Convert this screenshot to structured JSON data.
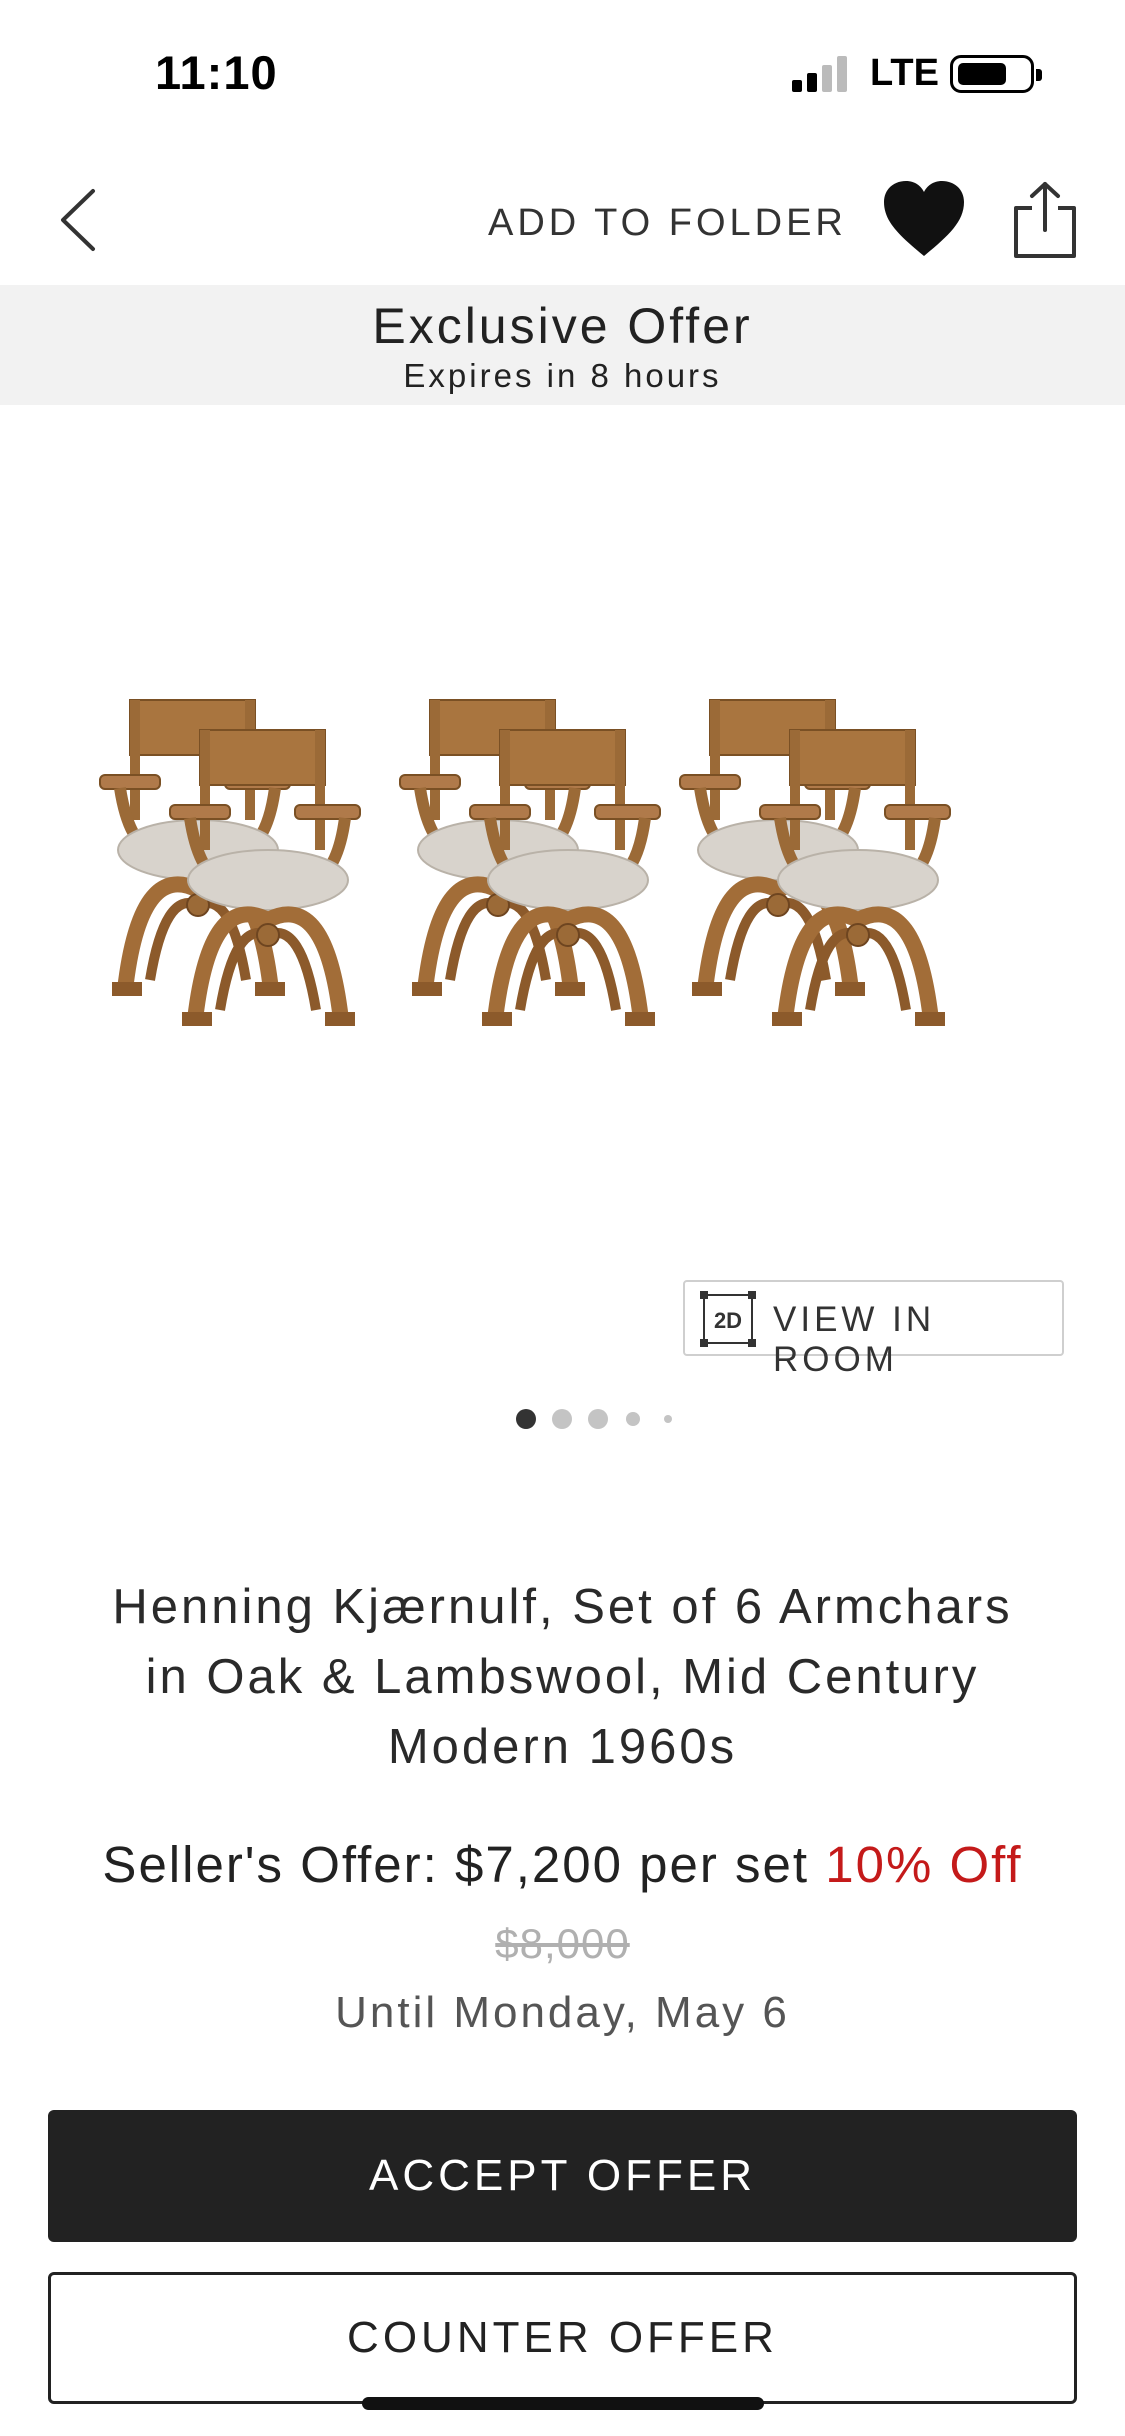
{
  "status_bar": {
    "time": "11:10",
    "network": "LTE",
    "icons": [
      "signal-icon",
      "battery-icon"
    ]
  },
  "nav": {
    "back_icon": "chevron-left-icon",
    "add_to_folder": "ADD TO FOLDER",
    "favorite_icon": "heart-icon",
    "share_icon": "share-icon"
  },
  "offer_banner": {
    "title": "Exclusive Offer",
    "subtitle": "Expires in 8 hours"
  },
  "gallery": {
    "image_description_icon": "armchair-set-image",
    "view_in_room": "VIEW IN ROOM",
    "view_in_room_badge": "2D",
    "pages_total": 5,
    "active_page": 1
  },
  "product": {
    "title_line1": "Henning Kjærnulf, Set of 6 Armchars",
    "title_line2": "in Oak & Lambswool, Mid Century",
    "title_line3": "Modern 1960s",
    "offer_prefix": "Seller's Offer: $7,200 per set",
    "discount": "10% Off",
    "original_price": "$8,000",
    "until": "Until Monday, May 6"
  },
  "actions": {
    "accept": "ACCEPT OFFER",
    "counter": "COUNTER OFFER"
  },
  "colors": {
    "accent_red": "#c41a1a",
    "primary_dark": "#222222",
    "banner_bg": "#f2f2f2",
    "wood": "#b07a4a",
    "wool": "#d8d3cc"
  }
}
